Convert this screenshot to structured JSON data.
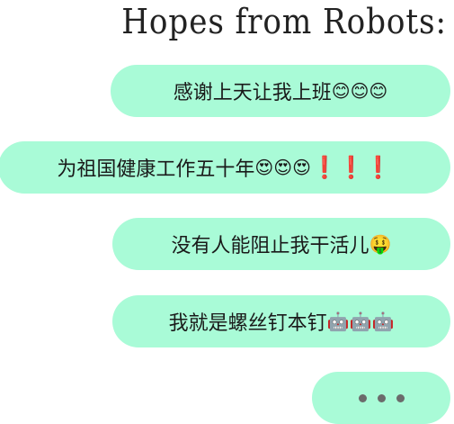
{
  "title": "Hopes from Robots:",
  "messages": [
    {
      "text": "感谢上天让我上班",
      "emojis": "😊😊😊"
    },
    {
      "text": "为祖国健康工作五十年",
      "emojis": "😍😍😍",
      "extra": "❗❗❗"
    },
    {
      "text": "没有人能阻止我干活儿",
      "emojis": "🤑"
    },
    {
      "text": "我就是螺丝钉本钉",
      "emojis": "🤖🤖🤖"
    }
  ],
  "colors": {
    "bubble": "#a9fbd7",
    "exclaim": "#e8424f",
    "dots": "#6b6b6b"
  }
}
